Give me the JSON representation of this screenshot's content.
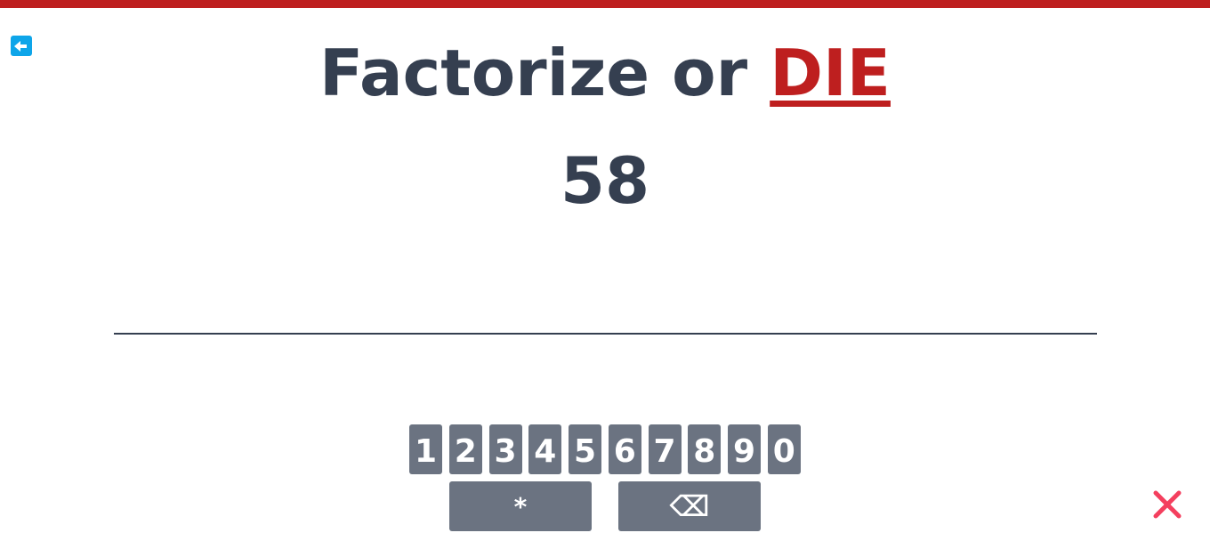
{
  "title": {
    "prefix": "Factorize or ",
    "emphasis": "DIE"
  },
  "puzzle": {
    "number": "58"
  },
  "answer": {
    "value": "",
    "placeholder": ""
  },
  "keypad": {
    "digits": [
      "1",
      "2",
      "3",
      "4",
      "5",
      "6",
      "7",
      "8",
      "9",
      "0"
    ],
    "multiply": "*",
    "backspace": "⌫"
  },
  "icons": {
    "back": "back-arrow-icon",
    "close": "close-icon"
  },
  "colors": {
    "accent": "#be1f1f",
    "text": "#353f50",
    "key_bg": "#6b7381",
    "back_button": "#0ea5e9",
    "close": "#f43f5e"
  }
}
